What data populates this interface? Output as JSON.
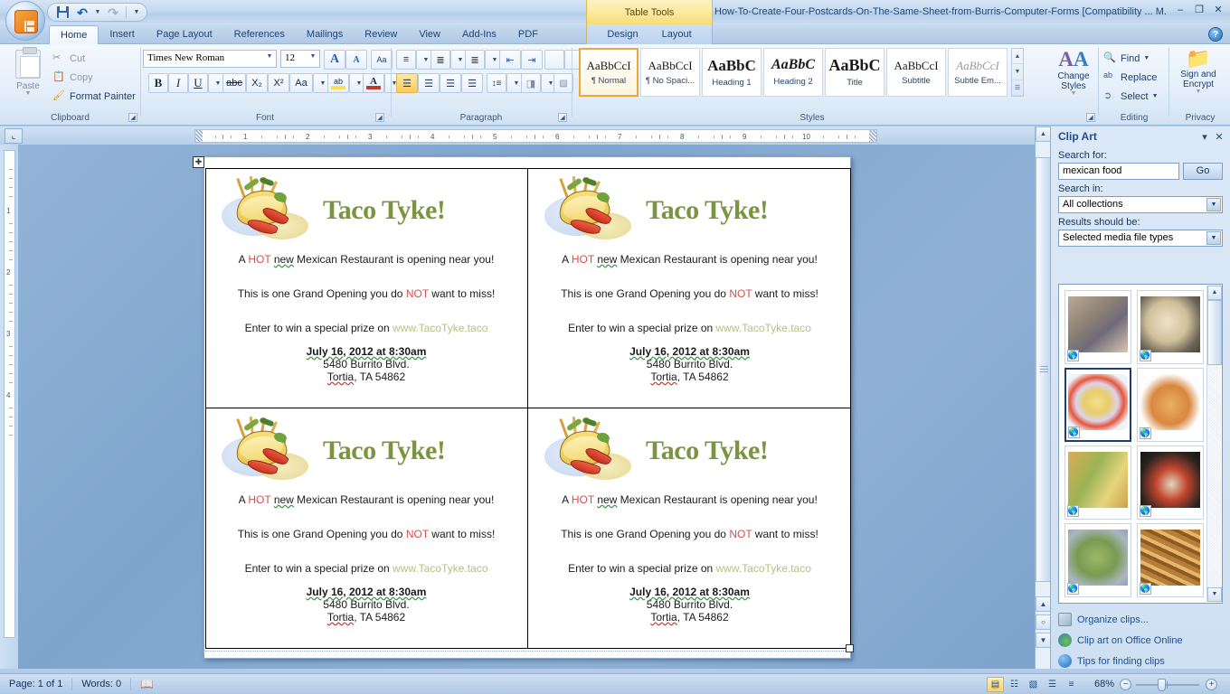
{
  "titlebar": {
    "app_icon": "office-orb-icon",
    "quick_access": [
      {
        "name": "save-button",
        "icon": "save-icon",
        "label": "Save"
      },
      {
        "name": "undo-button",
        "icon": "undo-icon",
        "label": "Undo"
      },
      {
        "name": "redo-button",
        "icon": "redo-icon",
        "label": "Redo"
      },
      {
        "name": "customize-qat-button",
        "icon": "chevron-down-icon",
        "label": "Customize Quick Access Toolbar"
      }
    ],
    "contextual_tools_label": "Table Tools",
    "document_title": "How-To-Create-Four-Postcards-On-The-Same-Sheet-from-Burris-Computer-Forms [Compatibility ... M.",
    "window_buttons": {
      "minimize": "–",
      "restore": "❐",
      "close": "✕"
    }
  },
  "ribbon": {
    "tabs": [
      {
        "label": "Home",
        "active": true
      },
      {
        "label": "Insert",
        "active": false
      },
      {
        "label": "Page Layout",
        "active": false
      },
      {
        "label": "References",
        "active": false
      },
      {
        "label": "Mailings",
        "active": false
      },
      {
        "label": "Review",
        "active": false
      },
      {
        "label": "View",
        "active": false
      },
      {
        "label": "Add-Ins",
        "active": false
      },
      {
        "label": "PDF",
        "active": false
      }
    ],
    "contextual_tabs": [
      {
        "label": "Design"
      },
      {
        "label": "Layout"
      }
    ],
    "help_button": "?",
    "groups": {
      "clipboard": {
        "label": "Clipboard",
        "paste": "Paste",
        "cut": "Cut",
        "copy": "Copy",
        "format_painter": "Format Painter"
      },
      "font": {
        "label": "Font",
        "font_name": "Times New Roman",
        "font_size": "12",
        "grow_font": "A",
        "shrink_font": "A",
        "clear_formatting": "Aa",
        "bold": "B",
        "italic": "I",
        "underline": "U",
        "strikethrough": "abc",
        "subscript": "X₂",
        "superscript": "X²",
        "change_case": "Aa",
        "highlight": "ab",
        "font_color": "A"
      },
      "paragraph": {
        "label": "Paragraph",
        "bullets": "bullets-icon",
        "numbering": "numbering-icon",
        "multilevel": "multilevel-list-icon",
        "decrease_indent": "decrease-indent-icon",
        "increase_indent": "increase-indent-icon",
        "sort": "sort-icon",
        "show_marks": "¶",
        "align_left": "align-left-icon",
        "align_center": "align-center-icon",
        "align_right": "align-right-icon",
        "justify": "justify-icon",
        "line_spacing": "line-spacing-icon",
        "shading": "shading-icon",
        "borders": "borders-icon"
      },
      "styles": {
        "label": "Styles",
        "items": [
          {
            "sample": "AaBbCcI",
            "name": "¶ Normal",
            "selected": true,
            "style": "normal"
          },
          {
            "sample": "AaBbCcI",
            "name": "¶ No Spaci...",
            "selected": false,
            "style": "normal"
          },
          {
            "sample": "AaBbC",
            "name": "Heading 1",
            "selected": false,
            "style": "h1"
          },
          {
            "sample": "AaBbC",
            "name": "Heading 2",
            "selected": false,
            "style": "h2"
          },
          {
            "sample": "AaBbC",
            "name": "Title",
            "selected": false,
            "style": "title"
          },
          {
            "sample": "AaBbCcI",
            "name": "Subtitle",
            "selected": false,
            "style": "normal"
          },
          {
            "sample": "AaBbCcI",
            "name": "Subtle Em...",
            "selected": false,
            "style": "subtle"
          }
        ],
        "change_styles": "Change Styles"
      },
      "editing": {
        "label": "Editing",
        "find": "Find",
        "replace": "Replace",
        "select": "Select"
      },
      "privacy": {
        "label": "Privacy",
        "sign_and_encrypt": "Sign and Encrypt"
      }
    }
  },
  "ruler": {
    "tab_stop_selector": "⌞",
    "horizontal_marks": [
      "1",
      "2",
      "3",
      "4",
      "5",
      "6",
      "7",
      "8",
      "9",
      "10"
    ],
    "vertical_marks": [
      "1",
      "2",
      "3",
      "4"
    ]
  },
  "document": {
    "table_move_handle": "✚",
    "postcards": [
      {
        "title": "Taco Tyke!",
        "line1_a": "A ",
        "line1_hot": "HOT",
        "line1_b": " ",
        "line1_new": "new",
        "line1_c": " Mexican Restaurant is opening near you!",
        "line2_a": "This is one Grand Opening you do ",
        "line2_not": "NOT",
        "line2_b": " want to miss!",
        "line3_a": "Enter to win a special prize on ",
        "line3_link": "www.TacoTyke.taco",
        "line4": "July 16, 2012 at 8:30am",
        "line5": "5480 Burrito Blvd.",
        "line6_city": "Tortia",
        "line6_rest": ", TA 54862"
      },
      {
        "title": "Taco Tyke!",
        "line1_a": "A ",
        "line1_hot": "HOT",
        "line1_b": " ",
        "line1_new": "new",
        "line1_c": " Mexican Restaurant is opening near you!",
        "line2_a": "This is one Grand Opening you do ",
        "line2_not": "NOT",
        "line2_b": " want to miss!",
        "line3_a": "Enter to win a special prize on ",
        "line3_link": "www.TacoTyke.taco",
        "line4": "July 16, 2012 at 8:30am",
        "line5": "5480 Burrito Blvd.",
        "line6_city": "Tortia",
        "line6_rest": ", TA 54862"
      },
      {
        "title": "Taco Tyke!",
        "line1_a": "A ",
        "line1_hot": "HOT",
        "line1_b": " ",
        "line1_new": "new",
        "line1_c": " Mexican Restaurant is opening near you!",
        "line2_a": "This is one Grand Opening you do ",
        "line2_not": "NOT",
        "line2_b": " want to miss!",
        "line3_a": "Enter to win a special prize on ",
        "line3_link": "www.TacoTyke.taco",
        "line4": "July 16, 2012 at 8:30am",
        "line5": "5480 Burrito Blvd.",
        "line6_city": "Tortia",
        "line6_rest": ", TA 54862"
      },
      {
        "title": "Taco Tyke!",
        "line1_a": "A ",
        "line1_hot": "HOT",
        "line1_b": " ",
        "line1_new": "new",
        "line1_c": " Mexican Restaurant is opening near you!",
        "line2_a": "This is one Grand Opening you do ",
        "line2_not": "NOT",
        "line2_b": " want to miss!",
        "line3_a": "Enter to win a special prize on ",
        "line3_link": "www.TacoTyke.taco",
        "line4": "July 16, 2012 at 8:30am",
        "line5": "5480 Burrito Blvd.",
        "line6_city": "Tortia",
        "line6_rest": ", TA 54862"
      }
    ],
    "colors": {
      "title_green": "#7a943f",
      "accent_red": "#d4504a",
      "link_olive": "#b2c37c"
    }
  },
  "task_pane": {
    "title": "Clip Art",
    "menu_button": "▾",
    "close_button": "✕",
    "search_for_label": "Search for:",
    "search_value": "mexican food",
    "search_placeholder": "",
    "go_button": "Go",
    "search_in_label": "Search in:",
    "search_in_value": "All collections",
    "results_label": "Results should be:",
    "results_value": "Selected media file types",
    "thumbnails": [
      {
        "name": "clip-result-1",
        "selected": false,
        "kind": "photo",
        "c1": "#b8a898",
        "c2": "#6f6a7a",
        "c3": "#d9c9b0"
      },
      {
        "name": "clip-result-2",
        "selected": false,
        "kind": "photo",
        "c1": "#9a9086",
        "c2": "#6a6456",
        "c3": "#e7dcc7"
      },
      {
        "name": "clip-result-3",
        "selected": true,
        "kind": "clipart-taco",
        "c1": "#f2db86",
        "c2": "#d9503a",
        "c3": "#cfe0f3"
      },
      {
        "name": "clip-result-4",
        "selected": false,
        "kind": "clipart-bread",
        "c1": "#e2a857",
        "c2": "#cf7a42",
        "c3": "#ffffff"
      },
      {
        "name": "clip-result-5",
        "selected": false,
        "kind": "photo",
        "c1": "#cfa54a",
        "c2": "#85a446",
        "c3": "#e8d47a"
      },
      {
        "name": "clip-result-6",
        "selected": false,
        "kind": "photo",
        "c1": "#1d1a16",
        "c2": "#c33b2c",
        "c3": "#dcd3b6"
      },
      {
        "name": "clip-result-7",
        "selected": false,
        "kind": "photo",
        "c1": "#7f9a5e",
        "c2": "#b9c6a4",
        "c3": "#9aa8b6"
      },
      {
        "name": "clip-result-8",
        "selected": false,
        "kind": "photo",
        "c1": "#b77a32",
        "c2": "#8a5a22",
        "c3": "#e0b46a"
      }
    ],
    "links": [
      {
        "label": "Organize clips...",
        "icon": "organize-clips-icon"
      },
      {
        "label": "Clip art on Office Online",
        "icon": "office-online-icon"
      },
      {
        "label": "Tips for finding clips",
        "icon": "help-icon"
      }
    ]
  },
  "statusbar": {
    "page": "Page: 1 of 1",
    "words": "Words: 0",
    "proofing_icon": "proofing-errors-icon",
    "view_buttons": [
      {
        "name": "print-layout-view",
        "glyph": "▤",
        "active": true
      },
      {
        "name": "full-screen-reading-view",
        "glyph": "☷",
        "active": false
      },
      {
        "name": "web-layout-view",
        "glyph": "▧",
        "active": false
      },
      {
        "name": "outline-view",
        "glyph": "☰",
        "active": false
      },
      {
        "name": "draft-view",
        "glyph": "≡",
        "active": false
      }
    ],
    "zoom": "68%",
    "zoom_out": "−",
    "zoom_in": "+"
  }
}
